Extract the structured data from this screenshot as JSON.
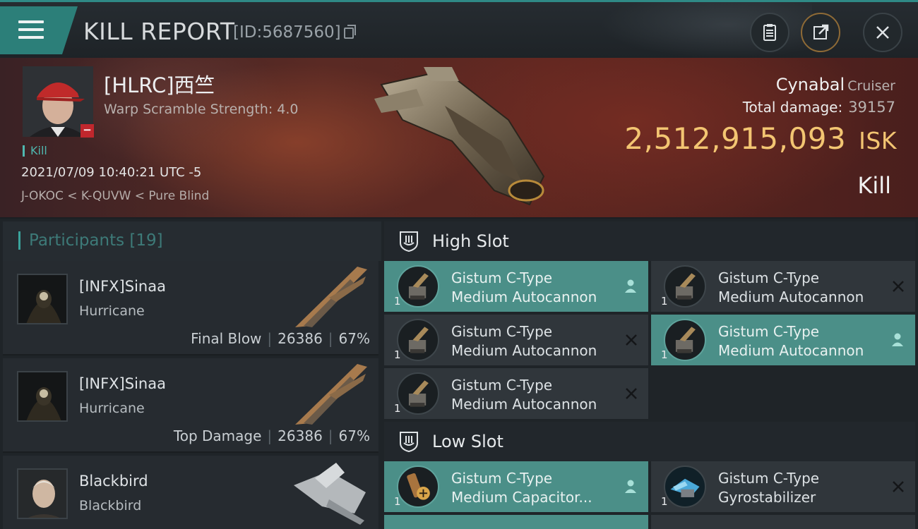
{
  "window": {
    "title": "KILL REPORT",
    "report_id": "[ID:5687560]"
  },
  "toolbar": {
    "menu_icon": "hamburger-menu-icon",
    "clipboard_icon": "clipboard-icon",
    "share_icon": "share-export-icon",
    "close_icon": "close-icon"
  },
  "victim": {
    "name": "[HLRC]西竺",
    "scramble": "Warp Scramble Strength: 4.0",
    "tag": "Kill",
    "datetime": "2021/07/09 10:40:21 UTC -5",
    "location": "J-OKOC < K-QUVW < Pure Blind",
    "ship_name": "Cynabal",
    "ship_class": "Cruiser",
    "total_damage_label": "Total damage:",
    "total_damage": "39157",
    "isk_value": "2,512,915,093",
    "isk_unit": "ISK",
    "result": "Kill"
  },
  "participants": {
    "header": "Participants",
    "count": "[19]",
    "rows": [
      {
        "name": "[INFX]Sinaa",
        "ship": "Hurricane",
        "label": "Final Blow",
        "damage": "26386",
        "percent": "67%"
      },
      {
        "name": "[INFX]Sinaa",
        "ship": "Hurricane",
        "label": "Top Damage",
        "damage": "26386",
        "percent": "67%"
      },
      {
        "name": "Blackbird",
        "ship": "Blackbird",
        "label": "",
        "damage": "",
        "percent": ""
      }
    ]
  },
  "slots": {
    "high": {
      "title": "High Slot",
      "modules": [
        {
          "line1": "Gistum C-Type",
          "line2": "Medium Autocannon",
          "qty": "1",
          "state": "fitted"
        },
        {
          "line1": "Gistum C-Type",
          "line2": "Medium Autocannon",
          "qty": "1",
          "state": "destroyed"
        },
        {
          "line1": "Gistum C-Type",
          "line2": "Medium Autocannon",
          "qty": "1",
          "state": "destroyed"
        },
        {
          "line1": "Gistum C-Type",
          "line2": "Medium Autocannon",
          "qty": "1",
          "state": "fitted"
        },
        {
          "line1": "Gistum C-Type",
          "line2": "Medium Autocannon",
          "qty": "1",
          "state": "destroyed"
        }
      ]
    },
    "low": {
      "title": "Low Slot",
      "modules": [
        {
          "line1": "Gistum C-Type",
          "line2": "Medium Capacitor...",
          "qty": "1",
          "state": "fitted"
        },
        {
          "line1": "Gistum C-Type",
          "line2": "Gyrostabilizer",
          "qty": "1",
          "state": "destroyed"
        }
      ]
    }
  },
  "colors": {
    "accent": "#2c7f79",
    "isk": "#f3c572",
    "fitted": "#4b8f88",
    "destroyed": "#30363b"
  }
}
